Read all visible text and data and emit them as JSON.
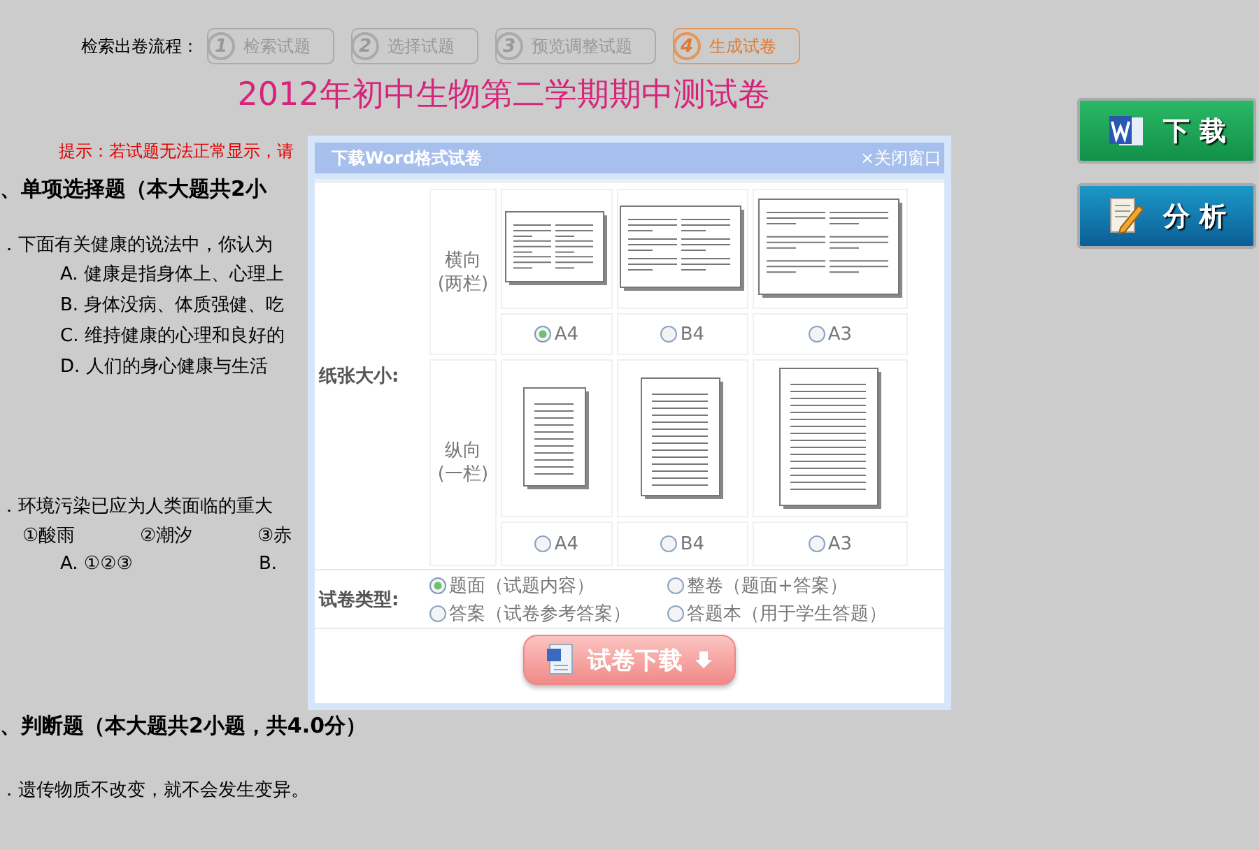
{
  "process": {
    "label": "检索出卷流程：",
    "steps": [
      {
        "number": "1",
        "label": "检索试题",
        "selected": false
      },
      {
        "number": "2",
        "label": "选择试题",
        "selected": false
      },
      {
        "number": "3",
        "label": "预览调整试题",
        "selected": false
      },
      {
        "number": "4",
        "label": "生成试卷",
        "selected": true
      }
    ]
  },
  "title": "2012年初中生物第二学期期中测试卷",
  "tip": "提示：若试题无法正常显示，请",
  "lines": [
    {
      "kind": "heading",
      "text": "、单项选择题（本大题共2小"
    },
    {
      "kind": "question",
      "text": "．下面有关健康的说法中，你认为"
    },
    {
      "kind": "option",
      "text": "A.  健康是指身体上、心理上"
    },
    {
      "kind": "option",
      "text": "B.  身体没病、体质强健、吃"
    },
    {
      "kind": "option",
      "text": "C.  维持健康的心理和良好的"
    },
    {
      "kind": "option",
      "text": "D.  人们的身心健康与生活"
    },
    {
      "kind": "question",
      "text": "．环境污染已应为人类面临的重大"
    },
    {
      "kind": "items",
      "parts": [
        "①酸雨",
        "②潮汐",
        "③赤"
      ]
    },
    {
      "kind": "choices",
      "parts": [
        "A.  ①②③",
        "B."
      ]
    },
    {
      "kind": "heading",
      "text": "、判断题（本大题共2小题，共4.0分）"
    },
    {
      "kind": "question",
      "text": "．遗传物质不改变，就不会发生变异。"
    }
  ],
  "side_buttons": [
    {
      "kind": "download",
      "label": "下 载"
    },
    {
      "kind": "analyze",
      "label": "分 析"
    }
  ],
  "dialog": {
    "title": "下载Word格式试卷",
    "close": "×关闭窗口",
    "paper_size": {
      "label": "纸张大小:",
      "orientations": [
        {
          "kind": "landscape",
          "label": "横向",
          "sub": "(两栏)",
          "sizes": [
            {
              "label": "A4",
              "selected": true
            },
            {
              "label": "B4",
              "selected": false
            },
            {
              "label": "A3",
              "selected": false
            }
          ]
        },
        {
          "kind": "portrait",
          "label": "纵向",
          "sub": "(一栏)",
          "sizes": [
            {
              "label": "A4",
              "selected": false
            },
            {
              "label": "B4",
              "selected": false
            },
            {
              "label": "A3",
              "selected": false
            }
          ]
        }
      ]
    },
    "paper_type": {
      "label": "试卷类型:",
      "options": [
        {
          "label": "题面（试题内容）",
          "selected": true
        },
        {
          "label": "整卷（题面+答案）",
          "selected": false
        },
        {
          "label": "答案（试卷参考答案）",
          "selected": false
        },
        {
          "label": "答题本（用于学生答题）",
          "selected": false
        }
      ]
    },
    "download_button": "试卷下载"
  }
}
